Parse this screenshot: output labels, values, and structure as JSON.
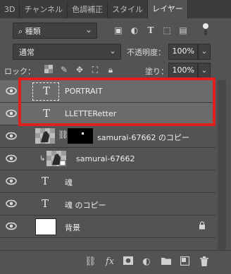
{
  "tabs": [
    "3D",
    "チャンネル",
    "色調補正",
    "スタイル",
    "レイヤー"
  ],
  "active_tab_index": 4,
  "filter": {
    "kind_label": "種類",
    "icons": [
      "pixel-filter-icon",
      "adjustment-filter-icon",
      "type-filter-icon",
      "shape-filter-icon",
      "smart-object-filter-icon",
      "filter-toggle-icon"
    ]
  },
  "blend": {
    "mode": "通常",
    "opacity_label": "不透明度：",
    "opacity_value": "100%"
  },
  "lock": {
    "label": "ロック：",
    "fill_label": "塗り：",
    "fill_value": "100%"
  },
  "layers": [
    {
      "name": "PORTRAIT",
      "type": "text",
      "thumb_text": "T",
      "selected": true
    },
    {
      "name": "LLETTERetter",
      "type": "text",
      "thumb_text": "T",
      "selected": true
    },
    {
      "name": "samurai-67662 のコピー",
      "type": "masked-image",
      "selected": false
    },
    {
      "name": "samurai-67662",
      "type": "smart-image-clipped",
      "selected": false
    },
    {
      "name": "魂",
      "type": "text",
      "thumb_text": "T",
      "selected": false
    },
    {
      "name": "魂 のコピー",
      "type": "text",
      "thumb_text": "T",
      "selected": false
    },
    {
      "name": "背景",
      "type": "background",
      "selected": false,
      "locked": true
    }
  ],
  "highlight_color": "#e0201c",
  "bottom_icons": [
    "link-layers-icon",
    "fx-icon",
    "add-mask-icon",
    "adjustment-layer-icon",
    "new-group-icon",
    "new-layer-icon",
    "delete-layer-icon"
  ],
  "fx_label": "fx"
}
